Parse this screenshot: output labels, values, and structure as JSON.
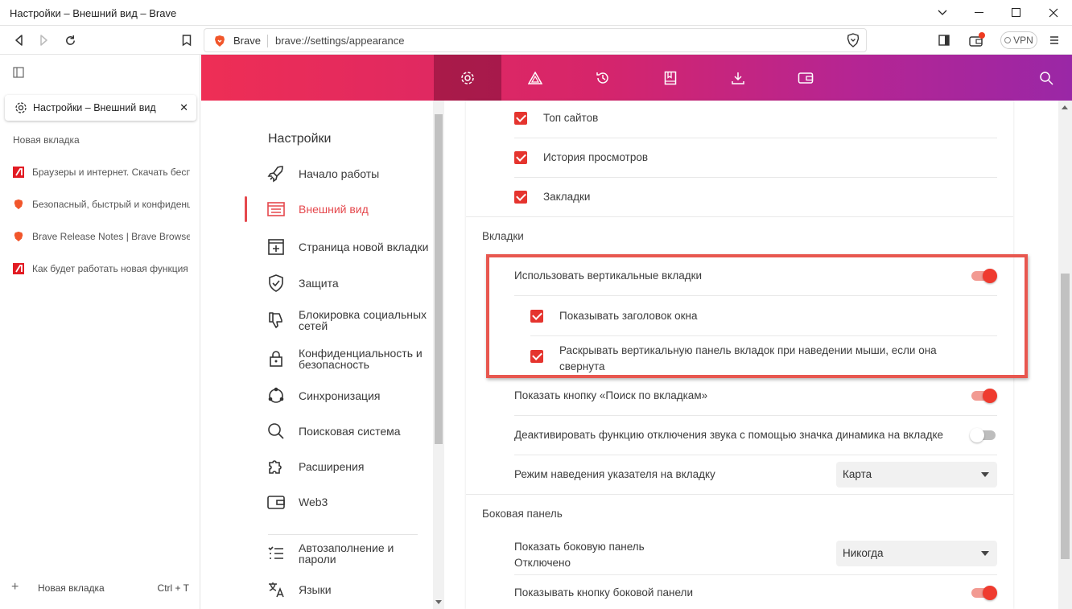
{
  "window": {
    "title": "Настройки – Внешний вид – Brave"
  },
  "address": {
    "brand": "Brave",
    "url": "brave://settings/appearance"
  },
  "toolbar": {
    "vpn_label": "VPN"
  },
  "sidebar": {
    "active_tab": "Настройки – Внешний вид",
    "new_tab_label": "Новая вкладка",
    "tabs": [
      {
        "label": "Браузеры и интернет. Скачать бесплатно",
        "icon": "red-site-icon"
      },
      {
        "label": "Безопасный, быстрый и конфиденциальный",
        "icon": "brave-lion-icon"
      },
      {
        "label": "Brave Release Notes | Brave Browser",
        "icon": "brave-lion-icon"
      },
      {
        "label": "Как будет работать новая функция",
        "icon": "red-site-icon"
      }
    ],
    "footer_label": "Новая вкладка",
    "footer_shortcut": "Ctrl + T"
  },
  "settings_nav": {
    "title": "Настройки",
    "items": [
      {
        "label": "Начало работы"
      },
      {
        "label": "Внешний вид",
        "active": true
      },
      {
        "label": "Страница новой вкладки"
      },
      {
        "label": "Защита"
      },
      {
        "label": "Блокировка социальных сетей"
      },
      {
        "label": "Конфиденциальность и безопасность"
      },
      {
        "label": "Синхронизация"
      },
      {
        "label": "Поисковая система"
      },
      {
        "label": "Расширения"
      },
      {
        "label": "Web3"
      },
      {
        "label": "Автозаполнение и пароли"
      },
      {
        "label": "Языки"
      }
    ]
  },
  "content": {
    "top_items": [
      "Топ сайтов",
      "История просмотров",
      "Закладки"
    ],
    "tabs_section": "Вкладки",
    "vertical_tabs": "Использовать вертикальные вкладки",
    "show_window_title": "Показывать заголовок окна",
    "expand_on_hover_line1": "Раскрывать вертикальную панель вкладок при наведении мыши, если она",
    "expand_on_hover_line2": "свернута",
    "search_tabs_button": "Показать кнопку «Поиск по вкладкам»",
    "mute_icon": "Деактивировать функцию отключения звука с помощью значка динамика на вкладке",
    "hover_mode": "Режим наведения указателя на вкладку",
    "hover_mode_value": "Карта",
    "side_panel_section": "Боковая панель",
    "show_side_panel": "Показать боковую панель",
    "show_side_panel_sub": "Отключено",
    "show_side_panel_value": "Никогда",
    "show_side_panel_button": "Показывать кнопку боковой панели"
  },
  "colors": {
    "accent": "#e5342e",
    "band_start": "#ee2e55",
    "band_end": "#9a27a6"
  }
}
